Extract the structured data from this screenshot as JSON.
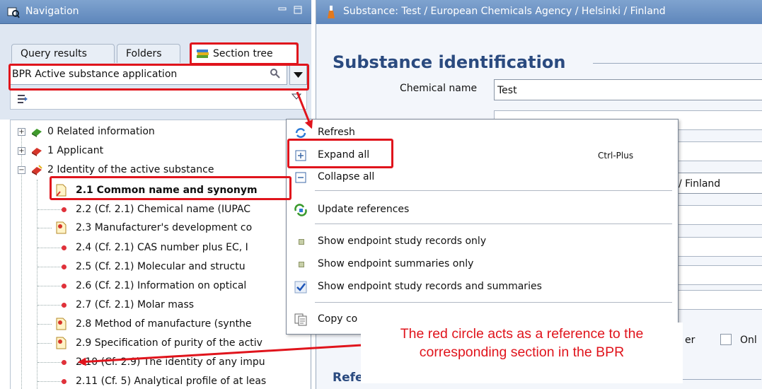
{
  "navigation": {
    "title": "Navigation",
    "tabs": [
      "Query results",
      "Folders",
      "Section tree"
    ],
    "combo_value": "BPR Active substance application",
    "tree": [
      {
        "label": "0 Related information"
      },
      {
        "label": "1 Applicant"
      },
      {
        "label": "2 Identity of the active substance"
      },
      {
        "label": "2.1 Common name and synonym"
      },
      {
        "label": "2.2 (Cf. 2.1) Chemical name (IUPAC"
      },
      {
        "label": "2.3 Manufacturer's development co"
      },
      {
        "label": "2.4 (Cf. 2.1) CAS number plus EC, I"
      },
      {
        "label": "2.5 (Cf. 2.1) Molecular and structu"
      },
      {
        "label": "2.6 (Cf. 2.1) Information on optical"
      },
      {
        "label": "2.7 (Cf. 2.1) Molar mass"
      },
      {
        "label": "2.8 Method of manufacture (synthe"
      },
      {
        "label": "2.9 Specification of purity of the activ"
      },
      {
        "label": "2.10 (Cf. 2.9) The identity of any impu"
      },
      {
        "label": "2.11 (Cf. 5) Analytical profile of at leas"
      }
    ]
  },
  "substance": {
    "title": "Substance: Test / European Chemicals Agency / Helsinki / Finland",
    "section_title": "Substance identification",
    "chemical_name_label": "Chemical name",
    "chemical_name_value": "Test",
    "location_value": "/ Finland",
    "er_label": "er",
    "only_label": "Onl",
    "reference_substance": "Reference substance"
  },
  "context_menu": {
    "refresh": "Refresh",
    "expand_all": "Expand all",
    "expand_shortcut": "Ctrl-Plus",
    "collapse_all": "Collapse all",
    "update_references": "Update references",
    "opt1": "Show endpoint study records only",
    "opt2": "Show endpoint summaries only",
    "opt3": "Show endpoint study records and summaries",
    "copy": "Copy co"
  },
  "annotation": {
    "line1": "The red circle acts as a reference to the",
    "line2": "corresponding section in the BPR"
  },
  "colors": {
    "highlight": "#e0141c",
    "header": "#6a90c4",
    "ref_dot": "#e0313a"
  }
}
